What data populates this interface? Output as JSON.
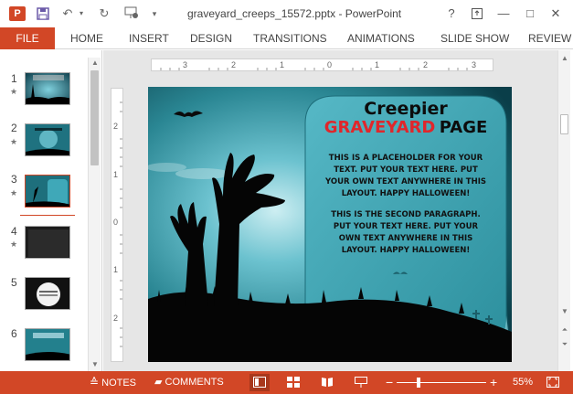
{
  "titlebar": {
    "app_icon": "P",
    "save_icon": "save-icon",
    "undo_icon": "undo-icon",
    "redo_icon": "redo-icon",
    "title": "graveyard_creeps_15572.pptx - PowerPoint",
    "help": "?",
    "ribbon_display": "↥",
    "minimize": "—",
    "restore": "□",
    "close": "✕"
  },
  "ribbon": {
    "file": "FILE",
    "tabs": [
      "HOME",
      "INSERT",
      "DESIGN",
      "TRANSITIONS",
      "ANIMATIONS",
      "SLIDE SHOW",
      "REVIEW"
    ]
  },
  "thumbnails": {
    "items": [
      {
        "num": "1",
        "star": "★"
      },
      {
        "num": "2",
        "star": "★"
      },
      {
        "num": "3",
        "star": "★"
      },
      {
        "num": "4",
        "star": "★"
      },
      {
        "num": "5",
        "star": ""
      },
      {
        "num": "6",
        "star": ""
      }
    ]
  },
  "rulers": {
    "horizontal": [
      "3",
      "2",
      "1",
      "0",
      "1",
      "2",
      "3"
    ],
    "vertical": [
      "2",
      "1",
      "0",
      "1",
      "2"
    ]
  },
  "slide": {
    "title_line1": "Creepier",
    "title_line2_red": "GRAVEYARD",
    "title_line2_black": "PAGE",
    "para1": [
      "THIS IS A PLACEHOLDER FOR YOUR",
      "TEXT. PUT YOUR TEXT HERE. PUT",
      "YOUR OWN TEXT ANYWHERE IN THIS",
      "LAYOUT. HAPPY HALLOWEEN!"
    ],
    "para2": [
      "THIS IS THE SECOND PARAGRAPH.",
      "PUT YOUR TEXT HERE. PUT YOUR",
      "OWN TEXT ANYWHERE IN THIS",
      "LAYOUT. HAPPY HALLOWEEN!"
    ]
  },
  "statusbar": {
    "notes": "NOTES",
    "comments": "COMMENTS",
    "zoom_minus": "−",
    "zoom_plus": "+",
    "zoom": "55%",
    "zoom_level": 0.55
  },
  "colors": {
    "accent": "#d24726",
    "slide_teal": "#2f8a97",
    "slide_red": "#e0262b"
  }
}
